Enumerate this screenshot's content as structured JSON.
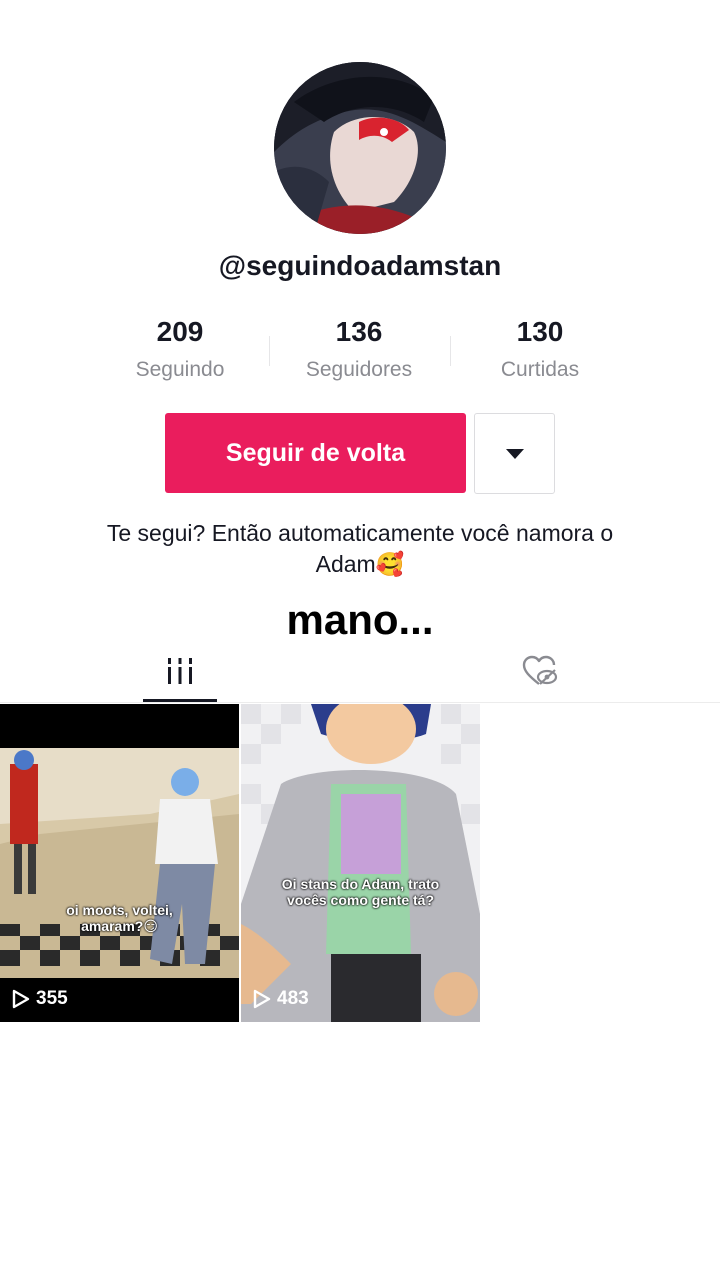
{
  "profile": {
    "username": "@seguindoadamstan",
    "bio_line1": "Te segui? Então automaticamente você namora o",
    "bio_line2": "Adam🥰",
    "link_text": "mano..."
  },
  "stats": [
    {
      "value": "209",
      "label": "Seguindo"
    },
    {
      "value": "136",
      "label": "Seguidores"
    },
    {
      "value": "130",
      "label": "Curtidas"
    }
  ],
  "actions": {
    "follow_back_label": "Seguir de volta",
    "dropdown_icon": "caret-down-icon"
  },
  "tabs": [
    {
      "icon": "videos-grid-icon",
      "active": true
    },
    {
      "icon": "liked-videos-hidden-icon",
      "active": false
    }
  ],
  "videos": [
    {
      "caption_line1": "oi moots, voltei,",
      "caption_line2": "amaram?😏",
      "views": "355"
    },
    {
      "caption_line1": "Oi stans do Adam, trato",
      "caption_line2": "vocês como gente tá?",
      "views": "483"
    }
  ],
  "colors": {
    "accent": "#ea1d5d",
    "text": "#161823",
    "muted": "#8a8b91"
  }
}
